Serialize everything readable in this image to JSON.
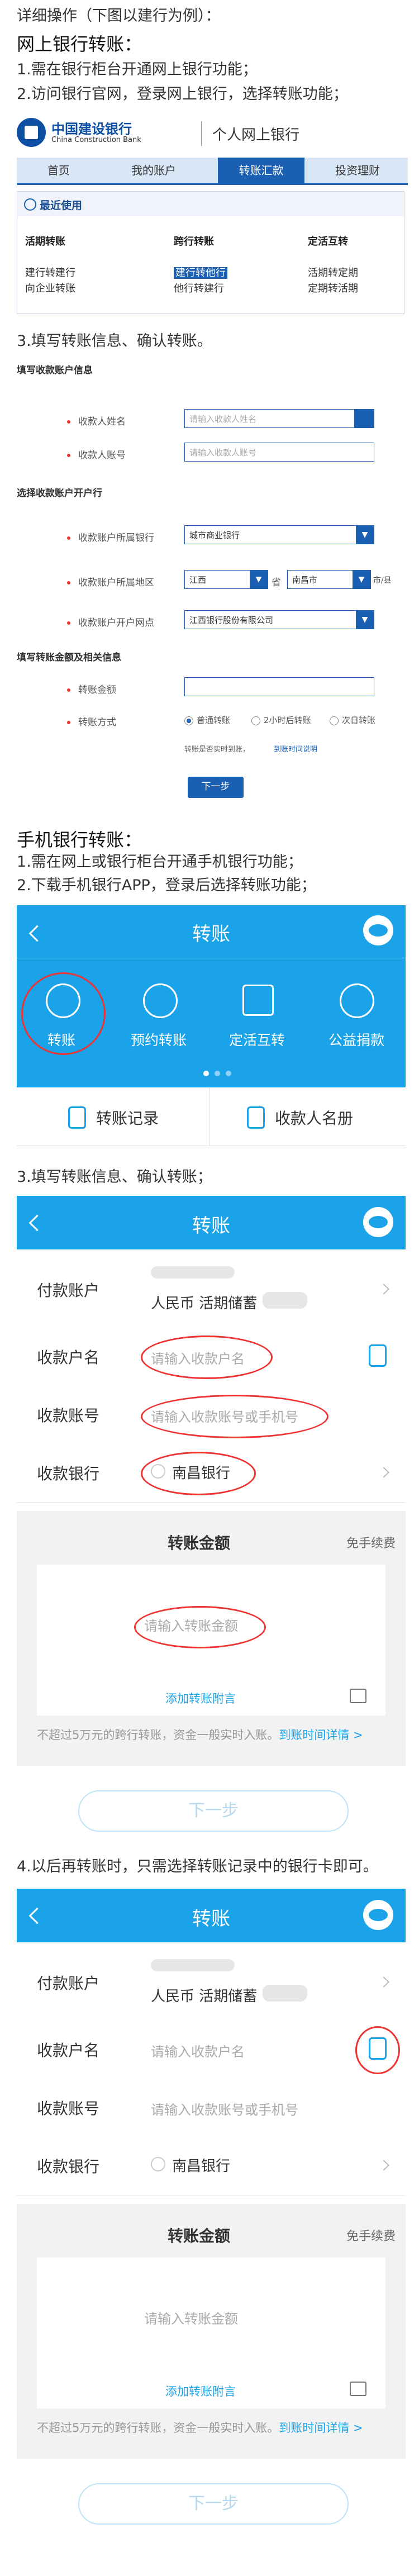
{
  "intro": {
    "line1": "详细操作（下图以建行为例）：",
    "heading": "网上银行转账：",
    "step1": "1.需在银行柜台开通网上银行功能；",
    "step2": "2.访问银行官网，登录网上银行，选择转账功能；"
  },
  "web": {
    "logo_cn": "中国建设银行",
    "logo_en": "China Construction Bank",
    "portal": "个人网上银行",
    "nav": [
      "首页",
      "我的账户",
      "转账汇款",
      "投资理财"
    ],
    "panel_title": "最近使用",
    "cols": [
      {
        "head": "活期转账",
        "items": [
          "建行转建行",
          "向企业转账"
        ]
      },
      {
        "head": "跨行转账",
        "items": [
          "建行转他行",
          "他行转建行"
        ]
      },
      {
        "head": "定活互转",
        "items": [
          "活期转定期",
          "定期转活期"
        ]
      }
    ]
  },
  "step3": "3.填写转账信息、确认转账。",
  "webform": {
    "sec1": "填写收款账户信息",
    "name_label": "收款人姓名",
    "name_ph": "请输入收款人姓名",
    "acct_label": "收款人账号",
    "acct_ph": "请输入收款人账号",
    "sec2": "选择收款账户开户行",
    "bank_label": "收款账户所属银行",
    "bank_val": "城市商业银行",
    "region_label": "收款账户所属地区",
    "province": "江西",
    "province_suffix": "省",
    "city": "南昌市",
    "city_suffix": "市/县",
    "branch_label": "收款账户开户网点",
    "branch_val": "江西银行股份有限公司",
    "sec3": "填写转账金额及相关信息",
    "amount_label": "转账金额",
    "method_label": "转账方式",
    "methods": [
      "普通转账",
      "2小时后转账",
      "次日转账"
    ],
    "hint": "转账是否实时到账，",
    "hint_link": "到账时间说明",
    "next": "下一步"
  },
  "mobile_intro": {
    "heading": "手机银行转账：",
    "step1": "1.需在网上或银行柜台开通手机银行功能；",
    "step2": "2.下载手机银行APP，登录后选择转账功能；"
  },
  "mhome": {
    "title": "转账",
    "icons": [
      "转账",
      "预约转账",
      "定活互转",
      "公益捐款"
    ],
    "records": "转账记录",
    "payees": "收款人名册"
  },
  "step3m": "3.填写转账信息、确认转账；",
  "mform": {
    "title": "转账",
    "pay_label": "付款账户",
    "pay_val": "人民币 活期储蓄",
    "name_label": "收款户名",
    "name_ph": "请输入收款户名",
    "acct_label": "收款账号",
    "acct_ph": "请输入收款账号或手机号",
    "bank_label": "收款银行",
    "bank_val": "南昌银行",
    "amount_title": "转账金额",
    "fee": "免手续费",
    "amount_ph": "请输入转账金额",
    "memo": "添加转账附言",
    "note": "不超过5万元的跨行转账，资金一般实时入账。",
    "note_link": "到账时间详情 >",
    "next": "下一步"
  },
  "step4": "4.以后再转账时，只需选择转账记录中的银行卡即可。",
  "colors": {
    "accent": "#1aa3e8",
    "bank_blue": "#1b5fb3",
    "highlight": "#e33333"
  }
}
